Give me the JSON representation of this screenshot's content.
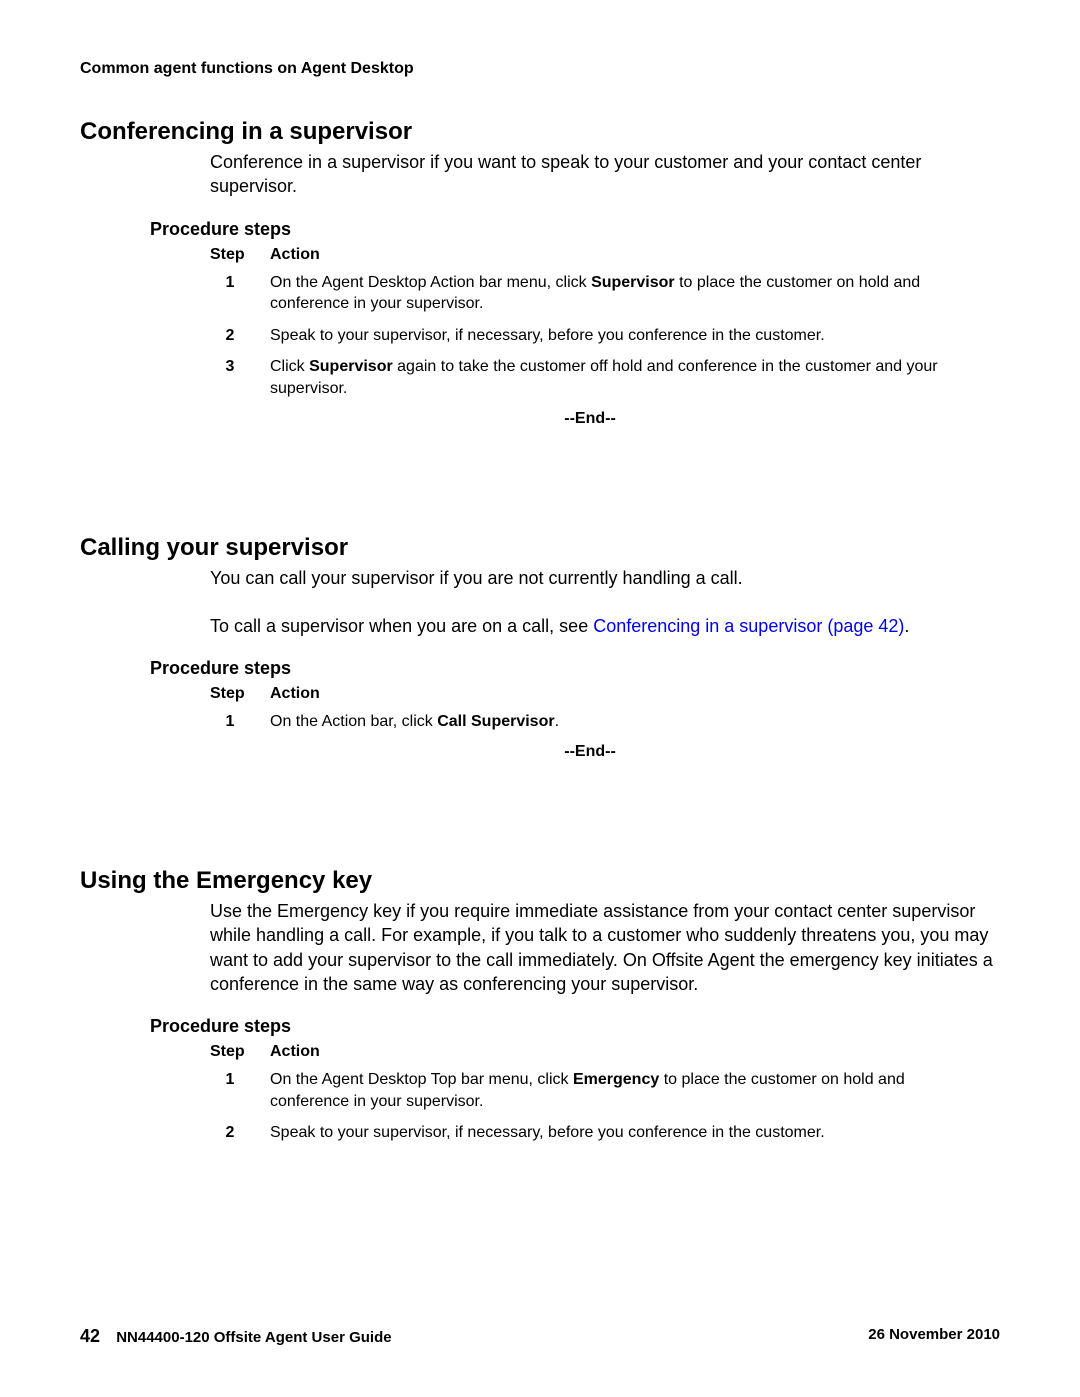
{
  "header": "Common agent functions on Agent Desktop",
  "sections": [
    {
      "heading": "Conferencing in a supervisor",
      "body_html": "Conference in a supervisor if you want to speak to your customer and your contact center supervisor.",
      "procedure_heading": "Procedure steps",
      "table_header_step": "Step",
      "table_header_action": "Action",
      "steps": [
        {
          "num": "1",
          "action_html": "On the Agent Desktop Action bar menu, click <b>Supervisor</b> to place the customer on hold and conference in your supervisor."
        },
        {
          "num": "2",
          "action_html": "Speak to your supervisor, if necessary, before you conference in the customer."
        },
        {
          "num": "3",
          "action_html": "Click <b>Supervisor</b> again to take the customer off hold and conference in the customer and your supervisor."
        }
      ],
      "end": "--End--"
    },
    {
      "heading": "Calling your supervisor",
      "body_html": "You can call your supervisor if you are not currently handling a call.<br><br>To call a supervisor when you are on a call, see <span class=\"link\">Conferencing in a supervisor (page 42)</span>.",
      "procedure_heading": "Procedure steps",
      "table_header_step": "Step",
      "table_header_action": "Action",
      "steps": [
        {
          "num": "1",
          "action_html": "On the Action bar, click <b>Call Supervisor</b>."
        }
      ],
      "end": "--End--"
    },
    {
      "heading": "Using the Emergency key",
      "body_html": "Use the Emergency key if you require immediate assistance from your contact center supervisor while handling a call. For example, if you talk to a customer who suddenly threatens you, you may want to add your supervisor to the call immediately. On Offsite Agent the emergency key initiates a conference in the same way as conferencing your supervisor.",
      "procedure_heading": "Procedure steps",
      "table_header_step": "Step",
      "table_header_action": "Action",
      "steps": [
        {
          "num": "1",
          "action_html": "On the Agent Desktop Top bar menu, click <b>Emergency</b> to place the customer on hold and conference in your supervisor."
        },
        {
          "num": "2",
          "action_html": "Speak to your supervisor, if necessary, before you conference in the customer."
        }
      ],
      "end": ""
    }
  ],
  "footer": {
    "page_num": "42",
    "doc_title": "NN44400-120 Offsite Agent User Guide",
    "date": "26 November 2010"
  }
}
